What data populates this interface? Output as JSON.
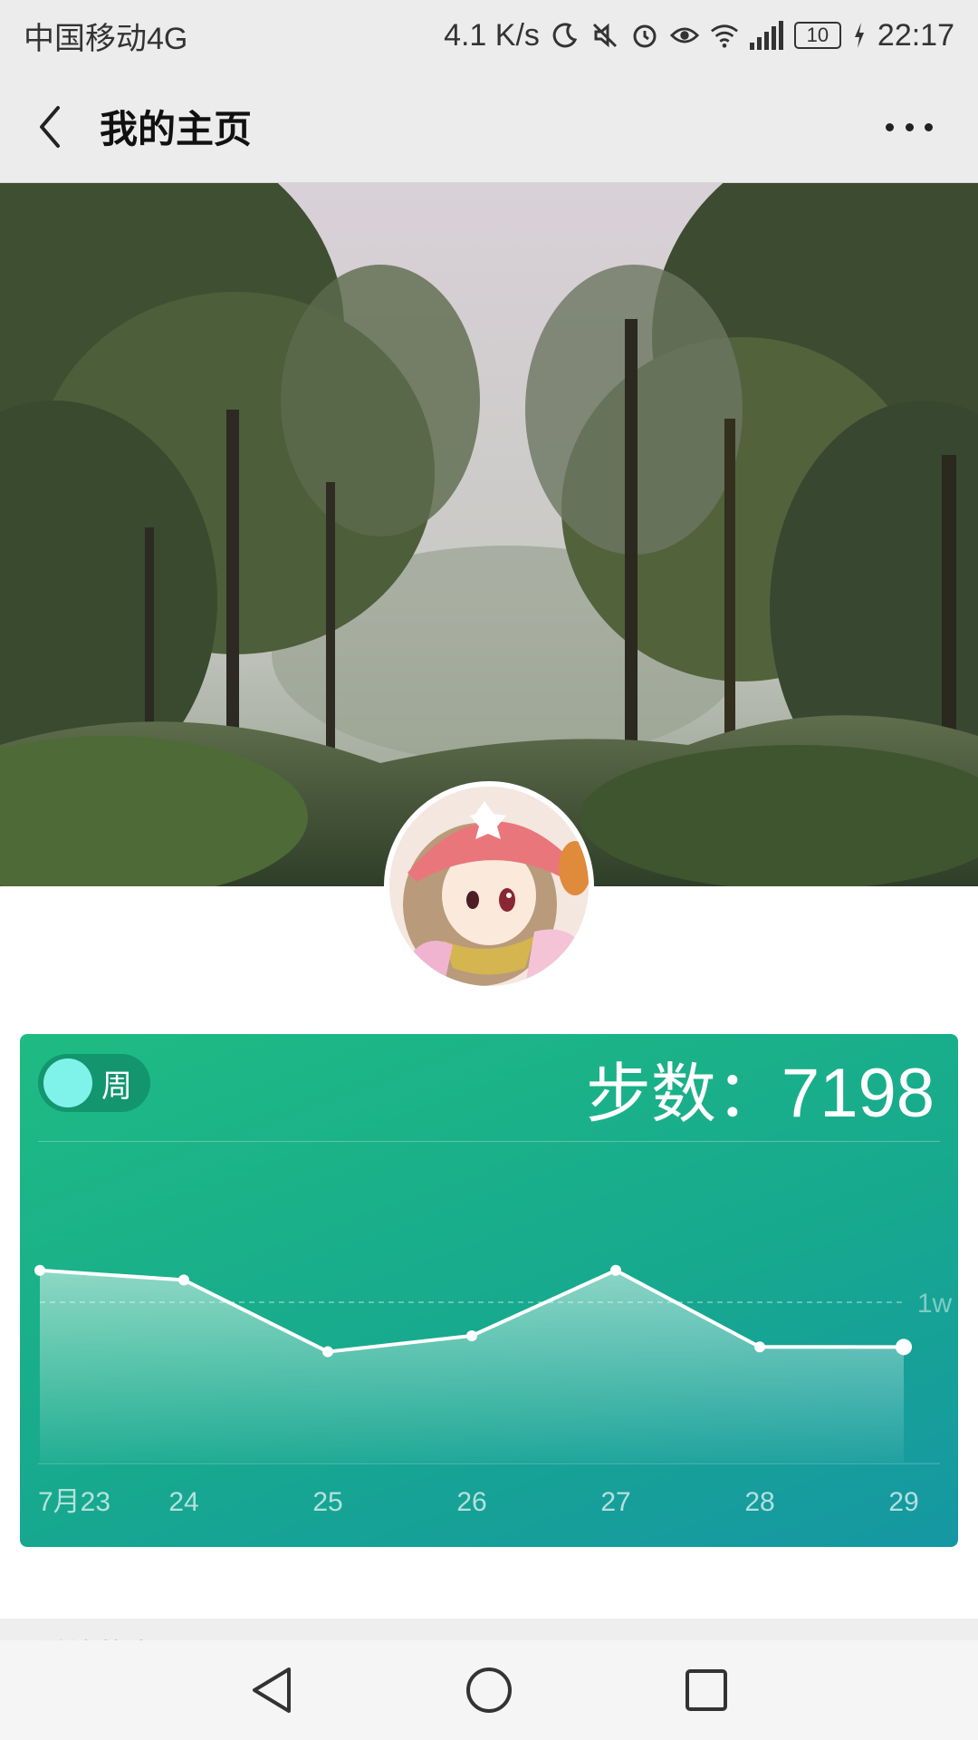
{
  "status_bar": {
    "carrier": "中国移动4G",
    "net_speed": "4.1 K/s",
    "battery": "10",
    "time": "22:17",
    "icons": [
      "moon-icon",
      "mute-icon",
      "alarm-icon",
      "eye-icon",
      "wifi-icon",
      "4g-signal-icon",
      "battery-icon",
      "charging-icon"
    ]
  },
  "header": {
    "title": "我的主页",
    "back_icon": "chevron-left-icon",
    "more_icon": "more-dots-icon"
  },
  "profile": {
    "cover_description_icon": "cover-photo",
    "avatar_icon": "avatar"
  },
  "step_card": {
    "period_toggle_label": "周",
    "steps_label": "步数：",
    "steps_value": "7198",
    "colors": {
      "gradient_start": "#1fbb83",
      "gradient_end": "#1597a3",
      "line": "#ffffff",
      "toggle_knob": "#7ff3ea"
    }
  },
  "chart_data": {
    "type": "area",
    "categories": [
      "7月23",
      "24",
      "25",
      "26",
      "27",
      "28",
      "29"
    ],
    "values": [
      12000,
      11400,
      6900,
      7900,
      12000,
      7200,
      7198
    ],
    "reference_line": {
      "value": 10000,
      "label": "1w"
    },
    "ylim": [
      0,
      20000
    ],
    "grid": false,
    "legend": "none"
  },
  "follow_section": {
    "label": "关注的人"
  },
  "nav_bar": {
    "icons": [
      "back-triangle-icon",
      "home-circle-icon",
      "recents-square-icon"
    ]
  }
}
